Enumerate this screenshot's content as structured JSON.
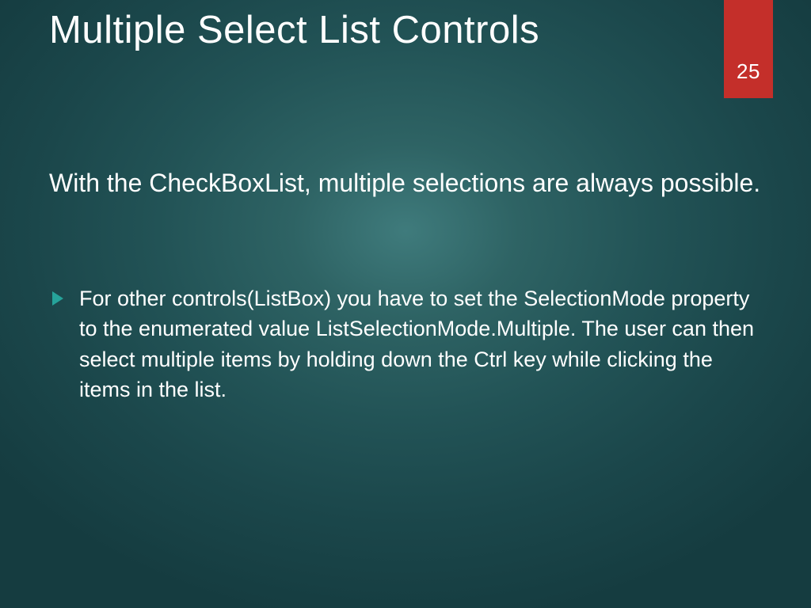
{
  "slide": {
    "title": "Multiple Select List Controls",
    "page_number": "25",
    "intro": "With the CheckBoxList, multiple selections are always possible.",
    "bullets": [
      "For other controls(ListBox) you have to set the SelectionMode property to the enumerated value ListSelectionMode.Multiple. The user can then select multiple items by holding down the Ctrl key while clicking the items in the list."
    ]
  },
  "colors": {
    "badge_bg": "#c42f2a",
    "bullet_arrow": "#26a39a"
  }
}
